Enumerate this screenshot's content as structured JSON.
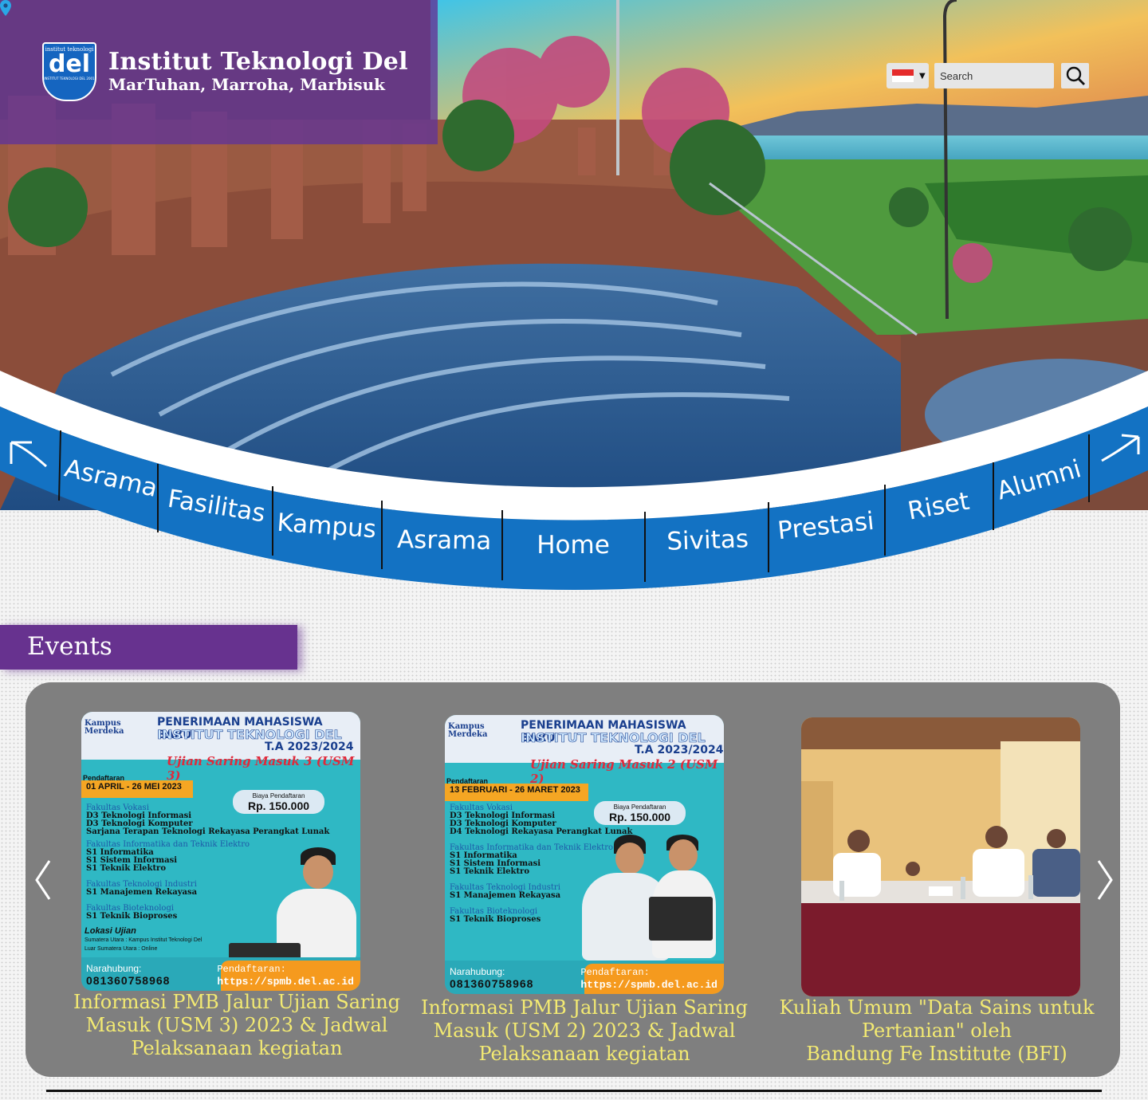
{
  "header": {
    "logo": {
      "top_text": "institut teknologi",
      "main_text": "del",
      "bottom_text": "INSTITUT TEKNOLOGI DEL 2001"
    },
    "title": "Institut Teknologi Del",
    "tagline": "MarTuhan, Marroha, Marbisuk",
    "language": {
      "icon": "indonesia-flag-icon"
    },
    "search": {
      "placeholder": "Search",
      "icon": "magnifier-icon"
    }
  },
  "nav": {
    "prev_icon": "arrow-left-icon",
    "next_icon": "arrow-right-icon",
    "items": [
      "Asrama",
      "Fasilitas",
      "Kampus",
      "Asrama",
      "Home",
      "Sivitas",
      "Prestasi",
      "Riset",
      "Alumni"
    ],
    "color": "#1372c3"
  },
  "events": {
    "heading": "Events",
    "accent": "#67328f",
    "cards": [
      {
        "poster": {
          "logo_text": "Kampus Merdeka",
          "headline": "PENERIMAAN MAHASISWA BARU",
          "institution": "INSTITUT TEKNOLOGI DEL",
          "year": "T.A 2023/2024",
          "test": "Ujian Saring Masuk 3 (USM 3)",
          "date_label": "Pendaftaran",
          "date": "01 APRIL - 26 MEI 2023",
          "fee_label": "Biaya Pendaftaran",
          "fee": "Rp. 150.000",
          "fac1": "Fakultas Vokasi",
          "fac1_items": [
            "D3 Teknologi Informasi",
            "D3 Teknologi Komputer",
            "Sarjana Terapan Teknologi Rekayasa Perangkat Lunak"
          ],
          "fac2": "Fakultas Informatika dan Teknik Elektro",
          "fac2_items": [
            "S1 Informatika",
            "S1 Sistem Informasi",
            "S1 Teknik Elektro"
          ],
          "fac3": "Fakultas Teknologi Industri",
          "fac3_items": [
            "S1 Manajemen Rekayasa"
          ],
          "fac4": "Fakultas Bioteknologi",
          "fac4_items": [
            "S1 Teknik Bioproses"
          ],
          "location_label": "Lokasi Ujian",
          "location_1": "Sumatera Utara : Kampus Institut Teknologi Del",
          "location_2": "Luar Sumatera Utara : Online",
          "contact_label": "Narahubung:",
          "contact": "081360758968",
          "reg_label": "Pendaftaran:",
          "reg_url": "https://spmb.del.ac.id"
        },
        "title_lines": [
          "Informasi PMB Jalur Ujian Saring",
          "Masuk (USM 3) 2023 & Jadwal",
          "Pelaksanaan kegiatan"
        ]
      },
      {
        "poster": {
          "logo_text": "Kampus Merdeka",
          "headline": "PENERIMAAN MAHASISWA BARU",
          "institution": "INSTITUT TEKNOLOGI DEL",
          "year": "T.A 2023/2024",
          "test": "Ujian Saring Masuk 2 (USM 2)",
          "date_label": "Pendaftaran",
          "date": "13 FEBRUARI - 26 MARET 2023",
          "fee_label": "Biaya Pendaftaran",
          "fee": "Rp. 150.000",
          "fac1": "Fakultas Vokasi",
          "fac1_items": [
            "D3 Teknologi Informasi",
            "D3 Teknologi Komputer",
            "D4 Teknologi Rekayasa Perangkat Lunak"
          ],
          "fac2": "Fakultas Informatika dan Teknik Elektro",
          "fac2_items": [
            "S1 Informatika",
            "S1 Sistem Informasi",
            "S1 Teknik Elektro"
          ],
          "fac3": "Fakultas Teknologi Industri",
          "fac3_items": [
            "S1 Manajemen Rekayasa"
          ],
          "fac4": "Fakultas Bioteknologi",
          "fac4_items": [
            "S1 Teknik Bioproses"
          ],
          "contact_label": "Narahubung:",
          "contact": "081360758968",
          "reg_label": "Pendaftaran:",
          "reg_url": "https://spmb.del.ac.id"
        },
        "title_lines": [
          "Informasi PMB Jalur Ujian Saring",
          "Masuk (USM 2) 2023 & Jadwal",
          "Pelaksanaan kegiatan"
        ]
      },
      {
        "photo": "seminar-panel-photo",
        "title_lines": [
          "Kuliah Umum \"Data Sains untuk",
          "Pertanian\" oleh",
          "Bandung Fe Institute (BFI)"
        ]
      }
    ]
  }
}
